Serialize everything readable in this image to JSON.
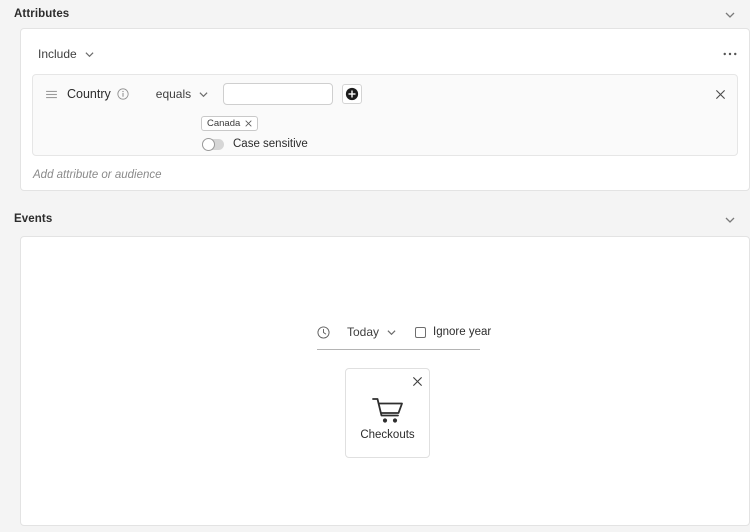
{
  "attributes": {
    "header": {
      "title": "Attributes",
      "collapse_icon": "chevron-down-icon"
    },
    "include_dropdown": {
      "label": "Include",
      "chevron_icon": "chevron-down-icon"
    },
    "more_options_label": "•••",
    "rule": {
      "drag_handle_icon": "drag-handle-icon",
      "name": "Country",
      "info_icon": "info-icon",
      "operator": "equals",
      "operator_chevron_icon": "chevron-down-icon",
      "value_input": "",
      "value_placeholder": "",
      "add_value_icon": "plus-circle-icon",
      "remove_icon": "close-icon",
      "chips": [
        {
          "label": "Canada",
          "remove_icon": "close-icon"
        }
      ],
      "case_sensitive": {
        "label": "Case sensitive",
        "enabled": false
      }
    },
    "add_row_placeholder": "Add attribute or audience"
  },
  "events": {
    "header": {
      "title": "Events",
      "collapse_icon": "chevron-down-icon"
    },
    "date_filter": {
      "clock_icon": "clock-icon",
      "range_label": "Today",
      "range_chevron_icon": "chevron-down-icon",
      "ignore_year": {
        "label": "Ignore year",
        "checked": false,
        "checkbox_icon": "checkbox-unchecked-icon"
      }
    },
    "event_cards": [
      {
        "label": "Checkouts",
        "icon": "shopping-cart-icon",
        "close_icon": "close-icon"
      }
    ]
  },
  "colors": {
    "page_background": "#f4f4f4",
    "panel_background": "#ffffff",
    "panel_border": "#e3e3e3",
    "rule_card_background": "#fafafa",
    "text_primary": "#2c2c2c",
    "text_muted": "#8a8a8a",
    "toggle_off": "#d6d6d6",
    "divider": "#b4b4b4"
  }
}
